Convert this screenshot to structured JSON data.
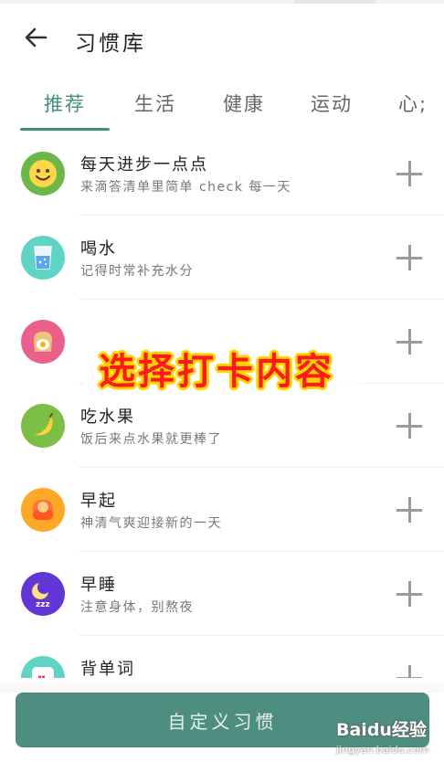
{
  "header": {
    "title": "习惯库",
    "back_icon": "arrow-left-icon"
  },
  "tabs": [
    {
      "label": "推荐",
      "active": true
    },
    {
      "label": "生活",
      "active": false
    },
    {
      "label": "健康",
      "active": false
    },
    {
      "label": "运动",
      "active": false
    },
    {
      "label": "心;",
      "active": false
    }
  ],
  "habits": [
    {
      "name": "每天进步一点点",
      "desc": "来滴答清单里简单 check 每一天",
      "icon": "smiley-icon",
      "color": "#6ab84a"
    },
    {
      "name": "喝水",
      "desc": "记得时常补充水分",
      "icon": "water-glass-icon",
      "color": "#5fd3c4"
    },
    {
      "name": "",
      "desc": "",
      "icon": "toast-egg-icon",
      "color": "#ec5f8a"
    },
    {
      "name": "吃水果",
      "desc": "饭后来点水果就更棒了",
      "icon": "banana-icon",
      "color": "#7dbf45"
    },
    {
      "name": "早起",
      "desc": "神清气爽迎接新的一天",
      "icon": "sunrise-icon",
      "color": "#ffa726"
    },
    {
      "name": "早睡",
      "desc": "注意身体，别熬夜",
      "icon": "moon-zzz-icon",
      "color": "#6236d6"
    },
    {
      "name": "背单词",
      "desc": "",
      "icon": "quote-icon",
      "color": "#5fd3c4"
    }
  ],
  "overlay": {
    "text": "选择打卡内容"
  },
  "footer": {
    "custom_button": "自定义习惯"
  },
  "watermark": {
    "logo": "Baidu经验",
    "url": "jingyan.baidu.com"
  }
}
